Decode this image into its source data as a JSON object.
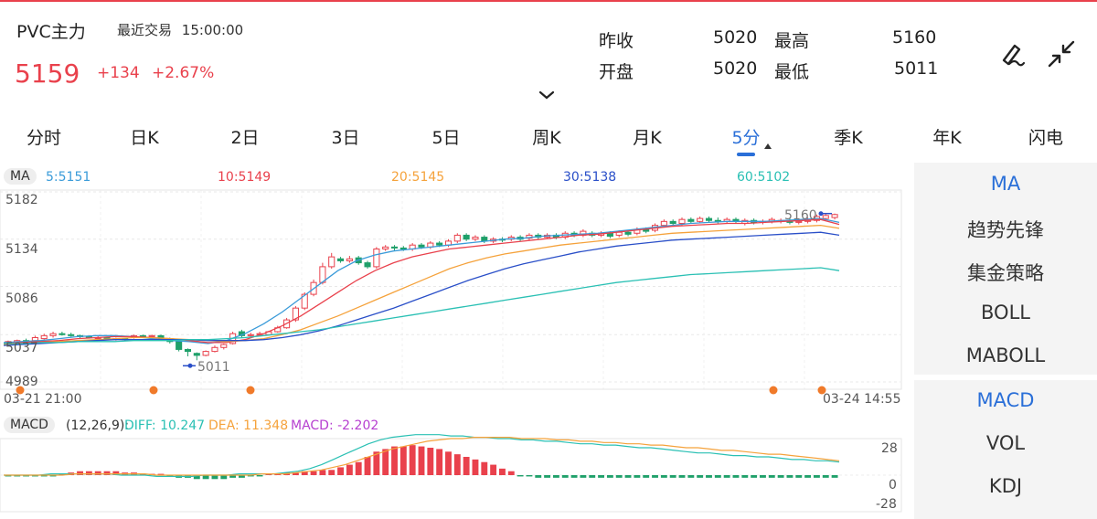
{
  "header": {
    "title": "PVC主力",
    "last_trade_label": "最近交易",
    "last_trade_time": "15:00:00",
    "price": "5159",
    "change": "+134",
    "change_pct": "+2.67%",
    "prev_close_label": "昨收",
    "prev_close": "5020",
    "high_label": "最高",
    "high": "5160",
    "open_label": "开盘",
    "open": "5020",
    "low_label": "最低",
    "low": "5011",
    "accent_up": "#e9414c",
    "accent_down": "#1fa06a",
    "icons": [
      "draw-icon",
      "collapse-icon",
      "chevron-down-icon"
    ]
  },
  "tabs": [
    "分时",
    "日K",
    "2日",
    "3日",
    "5日",
    "周K",
    "月K",
    "5分",
    "季K",
    "年K",
    "闪电"
  ],
  "active_tab": "5分",
  "main_chart": {
    "indicator_label": "MA",
    "ma_legend": [
      {
        "text": "5:5151",
        "color": "#3a9bd9"
      },
      {
        "text": "10:5149",
        "color": "#e9414c"
      },
      {
        "text": "20:5145",
        "color": "#f5a23b"
      },
      {
        "text": "30:5138",
        "color": "#2a4fc8"
      },
      {
        "text": "60:5102",
        "color": "#2ac0b4"
      }
    ],
    "y_labels": [
      "5182",
      "5134",
      "5086",
      "5037",
      "4989"
    ],
    "x_start_label": "03-21 21:00",
    "x_end_label": "03-24 14:55",
    "high_marker": "5160",
    "low_marker": "5011"
  },
  "macd_chart": {
    "indicator_label": "MACD",
    "params": "(12,26,9):",
    "diff": "DIFF: 10.247",
    "dea": "DEA: 11.348",
    "macd": "MACD: -2.202",
    "diff_color": "#2ac0b4",
    "dea_color": "#f5a23b",
    "macd_color": "#b63fd0",
    "y_labels": [
      "28",
      "0",
      "-28"
    ]
  },
  "sidebar": {
    "group1": [
      "MA",
      "趋势先锋",
      "集金策略",
      "BOLL",
      "MABOLL"
    ],
    "group2": [
      "MACD",
      "VOL",
      "KDJ"
    ],
    "active1": "MA",
    "active2": "MACD"
  },
  "chart_data": [
    {
      "type": "candlestick",
      "title": "",
      "ylim": [
        4989,
        5182
      ],
      "x_range": [
        "03-21 21:00",
        "03-24 14:55"
      ],
      "candles": [
        [
          5028,
          5030,
          5026,
          5031
        ],
        [
          5029,
          5031,
          5027,
          5032
        ],
        [
          5031,
          5030,
          5029,
          5033
        ],
        [
          5031,
          5034,
          5030,
          5036
        ],
        [
          5033,
          5036,
          5032,
          5038
        ],
        [
          5036,
          5038,
          5034,
          5040
        ],
        [
          5038,
          5037,
          5036,
          5040
        ],
        [
          5037,
          5036,
          5035,
          5039
        ],
        [
          5036,
          5035,
          5033,
          5037
        ],
        [
          5035,
          5034,
          5033,
          5036
        ],
        [
          5034,
          5034,
          5032,
          5036
        ],
        [
          5034,
          5033,
          5032,
          5035
        ],
        [
          5033,
          5033,
          5031,
          5034
        ],
        [
          5033,
          5032,
          5031,
          5034
        ],
        [
          5034,
          5036,
          5033,
          5037
        ],
        [
          5036,
          5035,
          5034,
          5037
        ],
        [
          5035,
          5036,
          5034,
          5037
        ],
        [
          5036,
          5033,
          5032,
          5037
        ],
        [
          5033,
          5030,
          5028,
          5034
        ],
        [
          5030,
          5022,
          5020,
          5031
        ],
        [
          5022,
          5020,
          5015,
          5023
        ],
        [
          5018,
          5016,
          5011,
          5019
        ],
        [
          5016,
          5020,
          5015,
          5021
        ],
        [
          5020,
          5024,
          5019,
          5026
        ],
        [
          5024,
          5027,
          5022,
          5028
        ],
        [
          5028,
          5038,
          5027,
          5040
        ],
        [
          5040,
          5036,
          5034,
          5042
        ],
        [
          5036,
          5037,
          5035,
          5039
        ],
        [
          5037,
          5038,
          5036,
          5040
        ],
        [
          5037,
          5040,
          5036,
          5041
        ],
        [
          5040,
          5044,
          5039,
          5046
        ],
        [
          5044,
          5052,
          5043,
          5054
        ],
        [
          5052,
          5064,
          5050,
          5066
        ],
        [
          5064,
          5078,
          5062,
          5080
        ],
        [
          5078,
          5090,
          5076,
          5093
        ],
        [
          5090,
          5106,
          5088,
          5110
        ],
        [
          5106,
          5116,
          5104,
          5120
        ],
        [
          5114,
          5112,
          5110,
          5116
        ],
        [
          5112,
          5114,
          5110,
          5117
        ],
        [
          5115,
          5110,
          5108,
          5117
        ],
        [
          5110,
          5106,
          5104,
          5112
        ],
        [
          5106,
          5124,
          5104,
          5126
        ],
        [
          5124,
          5126,
          5122,
          5128
        ],
        [
          5126,
          5125,
          5122,
          5128
        ],
        [
          5125,
          5124,
          5122,
          5127
        ],
        [
          5124,
          5128,
          5122,
          5130
        ],
        [
          5128,
          5126,
          5124,
          5130
        ],
        [
          5126,
          5130,
          5124,
          5132
        ],
        [
          5130,
          5128,
          5126,
          5132
        ],
        [
          5128,
          5132,
          5126,
          5134
        ],
        [
          5132,
          5138,
          5130,
          5140
        ],
        [
          5138,
          5134,
          5132,
          5140
        ],
        [
          5134,
          5136,
          5132,
          5138
        ],
        [
          5136,
          5132,
          5130,
          5138
        ],
        [
          5132,
          5134,
          5130,
          5136
        ],
        [
          5134,
          5133,
          5131,
          5136
        ],
        [
          5134,
          5136,
          5132,
          5138
        ],
        [
          5136,
          5134,
          5132,
          5138
        ],
        [
          5135,
          5138,
          5133,
          5140
        ],
        [
          5138,
          5136,
          5134,
          5140
        ],
        [
          5136,
          5138,
          5134,
          5140
        ],
        [
          5138,
          5136,
          5134,
          5140
        ],
        [
          5136,
          5140,
          5134,
          5142
        ],
        [
          5140,
          5138,
          5136,
          5142
        ],
        [
          5138,
          5142,
          5136,
          5144
        ],
        [
          5140,
          5138,
          5136,
          5142
        ],
        [
          5138,
          5140,
          5136,
          5142
        ],
        [
          5140,
          5137,
          5135,
          5142
        ],
        [
          5138,
          5141,
          5136,
          5143
        ],
        [
          5141,
          5139,
          5137,
          5143
        ],
        [
          5140,
          5144,
          5138,
          5146
        ],
        [
          5144,
          5142,
          5140,
          5146
        ],
        [
          5143,
          5148,
          5141,
          5150
        ],
        [
          5148,
          5152,
          5146,
          5154
        ],
        [
          5152,
          5150,
          5148,
          5154
        ],
        [
          5150,
          5154,
          5148,
          5156
        ],
        [
          5154,
          5152,
          5150,
          5156
        ],
        [
          5152,
          5155,
          5150,
          5157
        ],
        [
          5155,
          5153,
          5151,
          5157
        ],
        [
          5153,
          5152,
          5150,
          5156
        ],
        [
          5152,
          5154,
          5150,
          5156
        ],
        [
          5154,
          5152,
          5150,
          5156
        ],
        [
          5150,
          5153,
          5148,
          5155
        ],
        [
          5153,
          5151,
          5149,
          5155
        ],
        [
          5151,
          5152,
          5149,
          5154
        ],
        [
          5152,
          5154,
          5150,
          5156
        ],
        [
          5152,
          5153,
          5150,
          5155
        ],
        [
          5153,
          5151,
          5149,
          5155
        ],
        [
          5151,
          5152,
          5149,
          5154
        ],
        [
          5152,
          5153,
          5150,
          5156
        ],
        [
          5153,
          5157,
          5151,
          5159
        ],
        [
          5155,
          5158,
          5153,
          5160
        ],
        [
          5156,
          5159,
          5154,
          5160
        ]
      ],
      "ma_lines": [
        {
          "name": "MA5",
          "values": [
            5029,
            5030,
            5031,
            5033,
            5035,
            5036,
            5036,
            5035,
            5033,
            5031,
            5030,
            5028,
            5031,
            5038,
            5048,
            5060,
            5074,
            5088,
            5102,
            5112,
            5118,
            5122,
            5124,
            5126,
            5128,
            5130,
            5132,
            5134,
            5135,
            5137,
            5138,
            5139,
            5140,
            5142,
            5144,
            5146,
            5148,
            5150,
            5151,
            5152,
            5152,
            5152,
            5153,
            5154,
            5155,
            5151
          ]
        },
        {
          "name": "MA10",
          "values": [
            5028,
            5029,
            5030,
            5031,
            5033,
            5034,
            5035,
            5035,
            5034,
            5033,
            5031,
            5029,
            5029,
            5032,
            5038,
            5046,
            5056,
            5068,
            5080,
            5092,
            5102,
            5110,
            5116,
            5120,
            5124,
            5126,
            5128,
            5130,
            5132,
            5134,
            5136,
            5138,
            5139,
            5141,
            5143,
            5145,
            5147,
            5148,
            5149,
            5150,
            5150,
            5151,
            5152,
            5153,
            5154,
            5149
          ]
        },
        {
          "name": "MA20",
          "values": [
            5027,
            5028,
            5029,
            5030,
            5031,
            5032,
            5033,
            5034,
            5034,
            5033,
            5032,
            5031,
            5030,
            5031,
            5033,
            5037,
            5042,
            5049,
            5056,
            5064,
            5072,
            5080,
            5088,
            5096,
            5104,
            5110,
            5115,
            5119,
            5122,
            5125,
            5128,
            5130,
            5132,
            5134,
            5136,
            5138,
            5140,
            5141,
            5142,
            5143,
            5144,
            5145,
            5146,
            5147,
            5148,
            5145
          ]
        },
        {
          "name": "MA30",
          "values": [
            5026,
            5027,
            5028,
            5029,
            5030,
            5031,
            5032,
            5032,
            5032,
            5032,
            5032,
            5031,
            5031,
            5031,
            5032,
            5034,
            5037,
            5041,
            5046,
            5052,
            5058,
            5064,
            5071,
            5078,
            5085,
            5092,
            5098,
            5104,
            5109,
            5113,
            5117,
            5121,
            5124,
            5127,
            5129,
            5131,
            5133,
            5134,
            5135,
            5136,
            5137,
            5138,
            5139,
            5140,
            5141,
            5138
          ]
        },
        {
          "name": "MA60",
          "values": [
            5028,
            5028,
            5029,
            5029,
            5030,
            5030,
            5030,
            5031,
            5031,
            5031,
            5032,
            5032,
            5033,
            5034,
            5036,
            5038,
            5040,
            5042,
            5045,
            5048,
            5051,
            5054,
            5057,
            5060,
            5063,
            5066,
            5069,
            5072,
            5075,
            5078,
            5081,
            5084,
            5087,
            5090,
            5092,
            5094,
            5096,
            5098,
            5099,
            5100,
            5101,
            5102,
            5103,
            5104,
            5105,
            5102
          ]
        }
      ]
    },
    {
      "type": "bar",
      "title": "MACD",
      "ylim": [
        -28,
        28
      ],
      "macd_hist": [
        -1,
        -1,
        -1,
        -1,
        -1,
        -1,
        1,
        2,
        3,
        3,
        3,
        3,
        3,
        2,
        2,
        1,
        1,
        1,
        -1,
        -2,
        -2,
        -3,
        -3,
        -3,
        -3,
        -2,
        -2,
        -1,
        -1,
        1,
        1,
        2,
        2,
        3,
        3,
        4,
        4,
        6,
        8,
        10,
        14,
        18,
        20,
        22,
        22,
        23,
        22,
        21,
        20,
        18,
        16,
        14,
        12,
        10,
        8,
        5,
        3,
        -1,
        -1,
        -2,
        -2,
        -2,
        -2,
        -2,
        -2,
        -2,
        -2,
        -2,
        -2,
        -2,
        -2,
        -2,
        -2,
        -2,
        -2,
        -2,
        -2,
        -2,
        -2,
        -2,
        -2,
        -2,
        -2,
        -2,
        -2,
        -2,
        -2,
        -2,
        -2,
        -2,
        -2,
        -2,
        -2
      ],
      "diff": [
        0,
        0,
        0,
        0,
        1,
        1,
        1,
        1,
        1,
        1,
        0,
        0,
        0,
        -1,
        -1,
        -1,
        -1,
        0,
        0,
        0,
        1,
        1,
        1,
        1,
        2,
        3,
        5,
        8,
        12,
        16,
        20,
        24,
        27,
        29,
        30,
        31,
        31,
        31,
        30,
        30,
        29,
        29,
        28,
        28,
        27,
        27,
        26,
        26,
        25,
        24,
        24,
        23,
        23,
        22,
        21,
        21,
        20,
        19,
        18,
        17,
        17,
        16,
        15,
        15,
        14,
        14,
        13,
        12,
        12,
        11,
        11,
        10
      ],
      "dea": [
        0,
        0,
        0,
        0,
        0,
        0,
        1,
        1,
        1,
        1,
        1,
        1,
        1,
        0,
        0,
        0,
        0,
        0,
        0,
        0,
        0,
        0,
        1,
        1,
        1,
        2,
        3,
        4,
        6,
        8,
        11,
        14,
        17,
        20,
        22,
        24,
        26,
        27,
        28,
        28,
        29,
        29,
        29,
        29,
        28,
        28,
        28,
        27,
        27,
        26,
        26,
        25,
        25,
        24,
        24,
        23,
        23,
        22,
        21,
        21,
        20,
        19,
        19,
        18,
        17,
        16,
        16,
        15,
        14,
        13,
        12,
        11
      ]
    }
  ]
}
